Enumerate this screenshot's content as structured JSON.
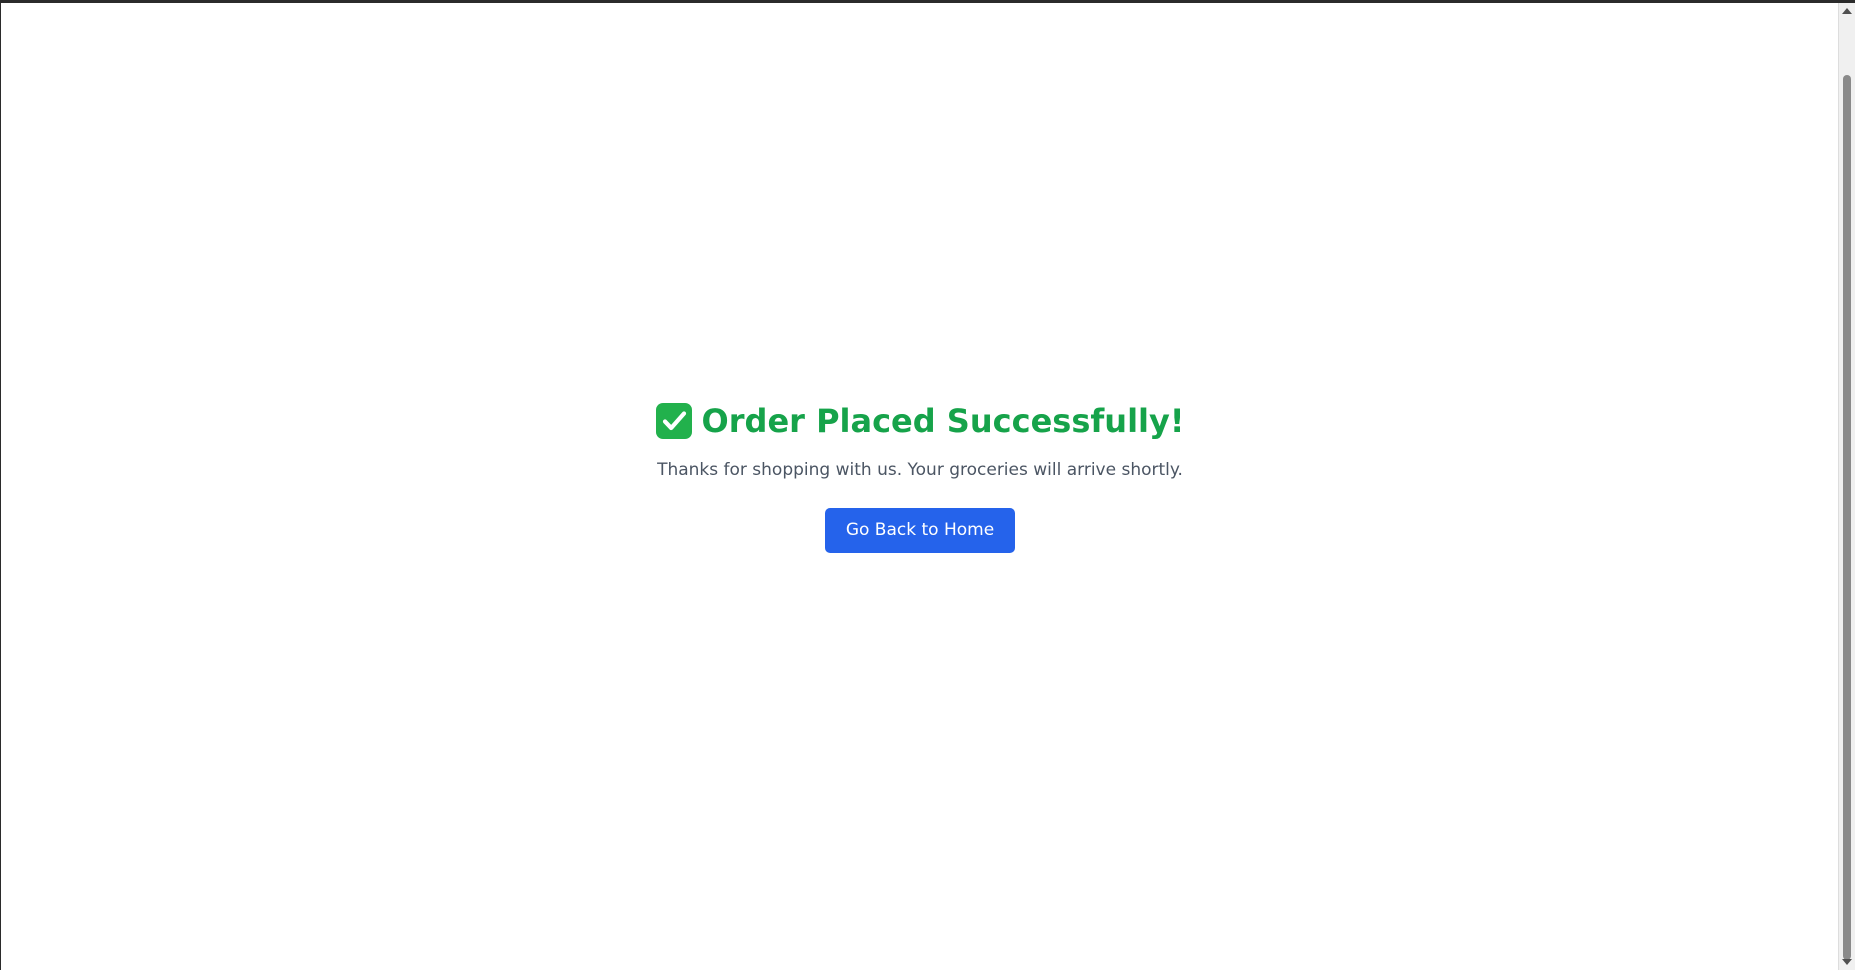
{
  "app": {
    "colors": {
      "success": "#16a34a",
      "message_text": "#4b5563",
      "button_bg": "#2563eb",
      "button_text": "#ffffff",
      "check_bg": "#22b14c"
    }
  },
  "success": {
    "icon": "check-mark-icon",
    "title": "Order Placed Successfully!",
    "message": "Thanks for shopping with us. Your groceries will arrive shortly.",
    "button_label": "Go Back to Home"
  }
}
